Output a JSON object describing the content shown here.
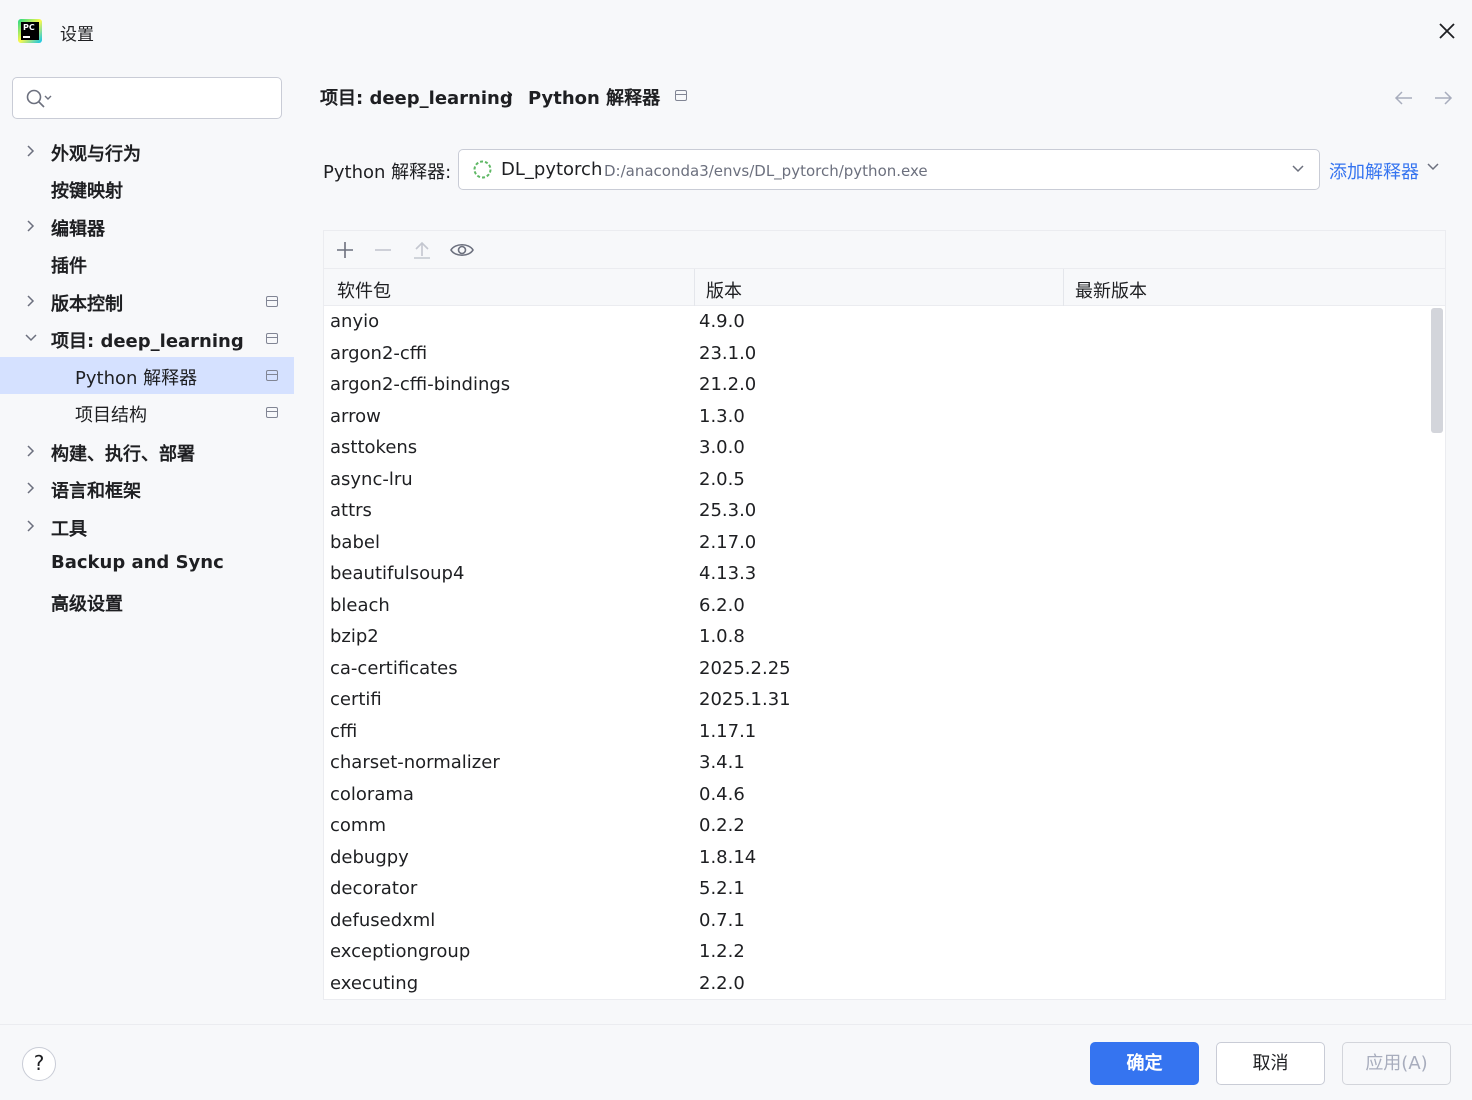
{
  "window": {
    "title": "设置",
    "logo_icon": "pycharm-logo-icon",
    "logo_text": "PC"
  },
  "search": {
    "placeholder": "",
    "icon": "search-icon"
  },
  "sidebar": {
    "items": [
      {
        "label": "外观与行为",
        "expandable": true,
        "expanded": false,
        "bold": true,
        "indent": 0,
        "pinned": false
      },
      {
        "label": "按键映射",
        "expandable": false,
        "bold": true,
        "indent": 0,
        "pinned": false
      },
      {
        "label": "编辑器",
        "expandable": true,
        "expanded": false,
        "bold": true,
        "indent": 0,
        "pinned": false
      },
      {
        "label": "插件",
        "expandable": false,
        "bold": true,
        "indent": 0,
        "pinned": false
      },
      {
        "label": "版本控制",
        "expandable": true,
        "expanded": false,
        "bold": true,
        "indent": 0,
        "pinned": true
      },
      {
        "label": "项目: deep_learning",
        "expandable": true,
        "expanded": true,
        "bold": true,
        "indent": 0,
        "pinned": true
      },
      {
        "label": "Python 解释器",
        "expandable": false,
        "bold": false,
        "indent": 1,
        "pinned": true,
        "selected": true
      },
      {
        "label": "项目结构",
        "expandable": false,
        "bold": false,
        "indent": 1,
        "pinned": true
      },
      {
        "label": "构建、执行、部署",
        "expandable": true,
        "expanded": false,
        "bold": true,
        "indent": 0,
        "pinned": false
      },
      {
        "label": "语言和框架",
        "expandable": true,
        "expanded": false,
        "bold": true,
        "indent": 0,
        "pinned": false
      },
      {
        "label": "工具",
        "expandable": true,
        "expanded": false,
        "bold": true,
        "indent": 0,
        "pinned": false
      },
      {
        "label": "Backup and Sync",
        "expandable": false,
        "bold": true,
        "indent": 0,
        "pinned": false
      },
      {
        "label": "高级设置",
        "expandable": false,
        "bold": true,
        "indent": 0,
        "pinned": false
      }
    ]
  },
  "breadcrumb": {
    "project": "项目: deep_learning",
    "separator": "›",
    "page": "Python 解释器"
  },
  "interpreter": {
    "label": "Python 解释器:",
    "name": "DL_pytorch",
    "path": "D:/anaconda3/envs/DL_pytorch/python.exe",
    "add_label": "添加解释器"
  },
  "toolbar": {
    "icons": [
      "add-icon",
      "remove-icon",
      "upgrade-icon",
      "show-early-releases-icon"
    ]
  },
  "packages": {
    "columns": [
      "软件包",
      "版本",
      "最新版本"
    ],
    "rows": [
      {
        "name": "anyio",
        "version": "4.9.0",
        "latest": ""
      },
      {
        "name": "argon2-cffi",
        "version": "23.1.0",
        "latest": ""
      },
      {
        "name": "argon2-cffi-bindings",
        "version": "21.2.0",
        "latest": ""
      },
      {
        "name": "arrow",
        "version": "1.3.0",
        "latest": ""
      },
      {
        "name": "asttokens",
        "version": "3.0.0",
        "latest": ""
      },
      {
        "name": "async-lru",
        "version": "2.0.5",
        "latest": ""
      },
      {
        "name": "attrs",
        "version": "25.3.0",
        "latest": ""
      },
      {
        "name": "babel",
        "version": "2.17.0",
        "latest": ""
      },
      {
        "name": "beautifulsoup4",
        "version": "4.13.3",
        "latest": ""
      },
      {
        "name": "bleach",
        "version": "6.2.0",
        "latest": ""
      },
      {
        "name": "bzip2",
        "version": "1.0.8",
        "latest": ""
      },
      {
        "name": "ca-certificates",
        "version": "2025.2.25",
        "latest": ""
      },
      {
        "name": "certifi",
        "version": "2025.1.31",
        "latest": ""
      },
      {
        "name": "cffi",
        "version": "1.17.1",
        "latest": ""
      },
      {
        "name": "charset-normalizer",
        "version": "3.4.1",
        "latest": ""
      },
      {
        "name": "colorama",
        "version": "0.4.6",
        "latest": ""
      },
      {
        "name": "comm",
        "version": "0.2.2",
        "latest": ""
      },
      {
        "name": "debugpy",
        "version": "1.8.14",
        "latest": ""
      },
      {
        "name": "decorator",
        "version": "5.2.1",
        "latest": ""
      },
      {
        "name": "defusedxml",
        "version": "0.7.1",
        "latest": ""
      },
      {
        "name": "exceptiongroup",
        "version": "1.2.2",
        "latest": ""
      },
      {
        "name": "executing",
        "version": "2.2.0",
        "latest": ""
      }
    ]
  },
  "footer": {
    "help_label": "?",
    "ok_label": "确定",
    "cancel_label": "取消",
    "apply_label": "应用(A)"
  },
  "colors": {
    "accent": "#3574f0",
    "selection": "#d5e1ff",
    "background": "#f7f8fa"
  }
}
